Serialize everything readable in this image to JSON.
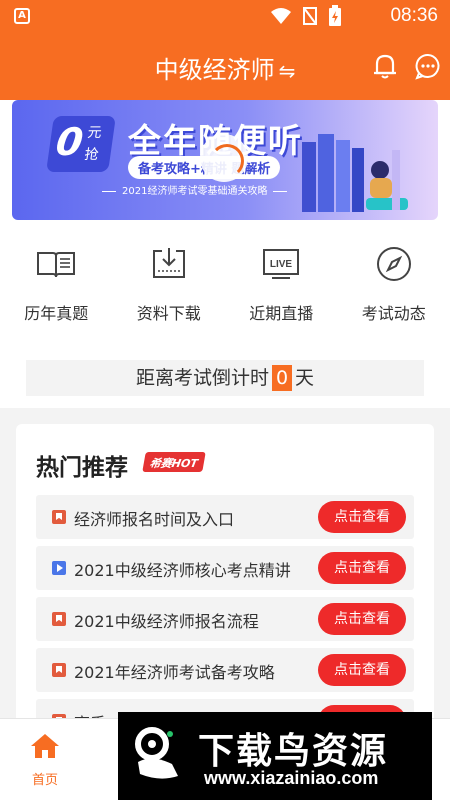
{
  "status_bar": {
    "app_badge": "A",
    "time": "08:36",
    "icons": [
      "wifi-icon",
      "no-signal-icon",
      "battery-charging-icon"
    ]
  },
  "header": {
    "title": "中级经济师",
    "swap_symbol": "⇋",
    "icons": [
      "bell-icon",
      "message-icon"
    ]
  },
  "banner": {
    "zero": "0",
    "yuan": "元",
    "qiang": "抢",
    "headline": "全年随便听",
    "subtitle": "备考攻略+精讲      题解析",
    "footer": "2021经济师考试零基础通关攻略"
  },
  "quick_nav": [
    {
      "label": "历年真题",
      "icon": "book-icon"
    },
    {
      "label": "资料下载",
      "icon": "download-icon"
    },
    {
      "label": "近期直播",
      "icon": "live-tv-icon"
    },
    {
      "label": "考试动态",
      "icon": "compass-icon"
    }
  ],
  "countdown": {
    "prefix": "距离考试倒计时",
    "days": "0",
    "suffix": "天"
  },
  "recommend": {
    "title": "热门推荐",
    "badge": "希赛HOT",
    "items": [
      {
        "title": "经济师报名时间及入口",
        "icon": "bookmark-icon",
        "action": "点击查看"
      },
      {
        "title": "2021中级经济师核心考点精讲",
        "icon": "play-icon",
        "action": "点击查看"
      },
      {
        "title": "2021中级经济师报名流程",
        "icon": "bookmark-icon",
        "action": "点击查看"
      },
      {
        "title": "2021年经济师考试备考攻略",
        "icon": "bookmark-icon",
        "action": "点击查看"
      },
      {
        "title": "高手",
        "icon": "bookmark-icon",
        "action": ""
      }
    ]
  },
  "tab_bar": {
    "home_label": "首页"
  },
  "watermark": {
    "brand": "下载鸟资源",
    "domain": "www.xiazainiao.com"
  },
  "colors": {
    "brand_orange": "#f76d22",
    "button_red": "#ee2a2a",
    "icon_blue": "#4a76e8"
  }
}
